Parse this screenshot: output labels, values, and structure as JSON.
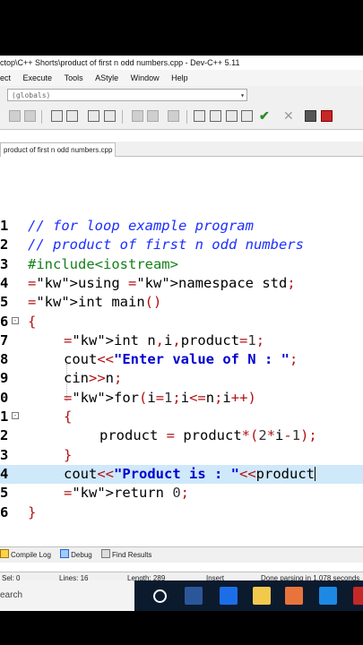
{
  "window": {
    "title": "ctop\\C++ Shorts\\product of first n odd numbers.cpp - Dev-C++ 5.11"
  },
  "menu": [
    "ect",
    "Execute",
    "Tools",
    "AStyle",
    "Window",
    "Help"
  ],
  "scope_combo": {
    "value": "(globals)"
  },
  "file_tab": {
    "label": "product of first n odd numbers.cpp"
  },
  "code_lines": [
    {
      "num": "1",
      "text": "// for loop example program"
    },
    {
      "num": "2",
      "text": "// product of first n odd numbers"
    },
    {
      "num": "3",
      "text": "#include<iostream>"
    },
    {
      "num": "4",
      "text": "using namespace std;"
    },
    {
      "num": "5",
      "text": "int main()"
    },
    {
      "num": "6",
      "text": "{"
    },
    {
      "num": "7",
      "text": "int n,i,product=1;"
    },
    {
      "num": "8",
      "text": "cout<<\"Enter value of N : \";"
    },
    {
      "num": "9",
      "text": "cin>>n;"
    },
    {
      "num": "0",
      "text": "for(i=1;i<=n;i++)"
    },
    {
      "num": "1",
      "text": "{"
    },
    {
      "num": "2",
      "text": "product = product*(2*i-1);"
    },
    {
      "num": "3",
      "text": "}"
    },
    {
      "num": "4",
      "text": "cout<<\"Product is : \"<<product"
    },
    {
      "num": "5",
      "text": "return 0;"
    },
    {
      "num": "6",
      "text": "}"
    }
  ],
  "bottom_tabs": [
    "Compile Log",
    "Debug",
    "Find Results"
  ],
  "status": {
    "sel": "Sel:  0",
    "lines": "Lines:  16",
    "length": "Length:  289",
    "mode": "Insert",
    "message": "Done parsing in 1.078 seconds"
  },
  "taskbar": {
    "search_text": "earch"
  }
}
